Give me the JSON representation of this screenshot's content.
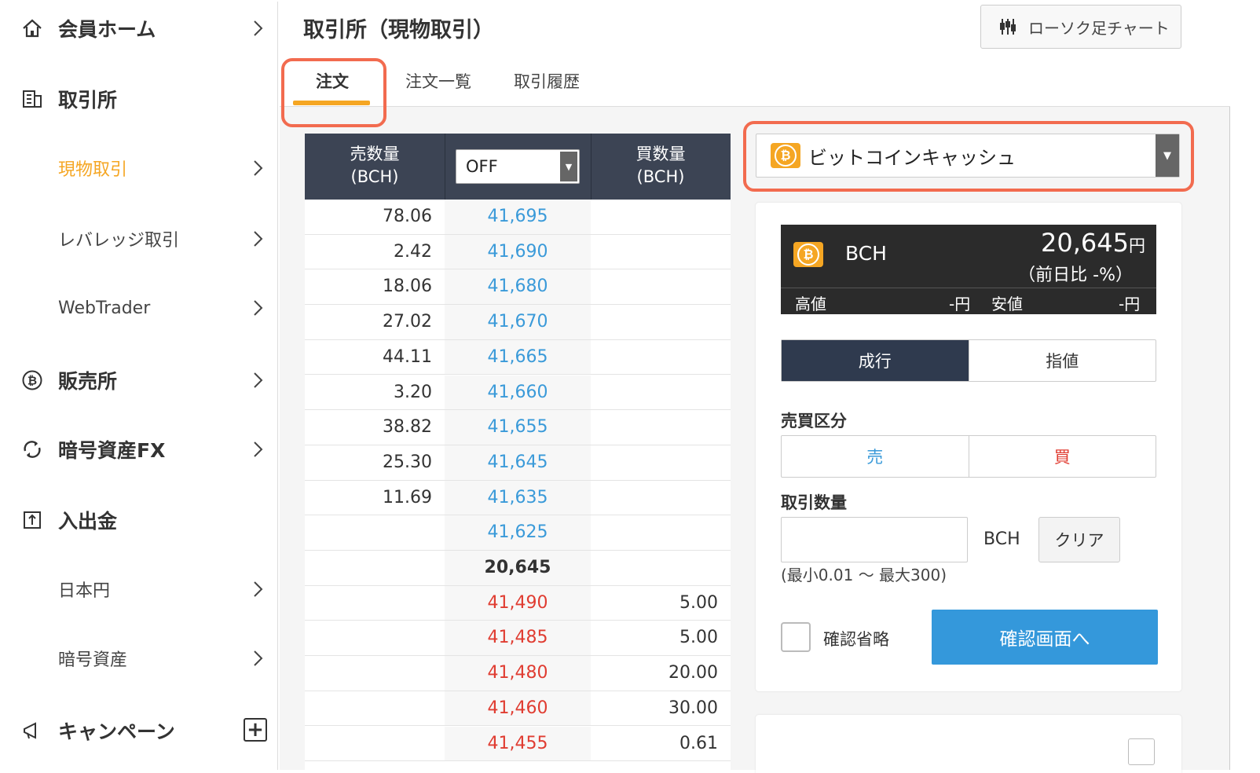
{
  "sidebar": {
    "items": [
      {
        "label": "会員ホーム",
        "icon": "home-icon"
      },
      {
        "label": "取引所",
        "icon": "building-icon"
      },
      {
        "label": "現物取引"
      },
      {
        "label": "レバレッジ取引"
      },
      {
        "label": "WebTrader"
      },
      {
        "label": "販売所",
        "icon": "bitcoin-icon"
      },
      {
        "label": "暗号資産FX",
        "icon": "exchange-icon"
      },
      {
        "label": "入出金",
        "icon": "deposit-icon"
      },
      {
        "label": "日本円"
      },
      {
        "label": "暗号資産"
      },
      {
        "label": "キャンペーン",
        "icon": "megaphone-icon"
      }
    ]
  },
  "header": {
    "title": "取引所（現物取引）",
    "chart_button": "ローソク足チャート",
    "tabs": [
      "注文",
      "注文一覧",
      "取引履歴"
    ]
  },
  "orderbook": {
    "sell_header": "売数量\n(BCH)",
    "buy_header": "買数量\n(BCH)",
    "sell_header_l1": "売数量",
    "sell_header_l2": "(BCH)",
    "buy_header_l1": "買数量",
    "buy_header_l2": "(BCH)",
    "filter_value": "OFF",
    "asks": [
      {
        "qty": "78.06",
        "price": "41,695"
      },
      {
        "qty": "2.42",
        "price": "41,690"
      },
      {
        "qty": "18.06",
        "price": "41,680"
      },
      {
        "qty": "27.02",
        "price": "41,670"
      },
      {
        "qty": "44.11",
        "price": "41,665"
      },
      {
        "qty": "3.20",
        "price": "41,660"
      },
      {
        "qty": "38.82",
        "price": "41,655"
      },
      {
        "qty": "25.30",
        "price": "41,645"
      },
      {
        "qty": "11.69",
        "price": "41,635"
      },
      {
        "qty": "",
        "price": "41,625"
      }
    ],
    "last_price": "20,645",
    "bids": [
      {
        "price": "41,490",
        "qty": "5.00"
      },
      {
        "price": "41,485",
        "qty": "5.00"
      },
      {
        "price": "41,480",
        "qty": "20.00"
      },
      {
        "price": "41,460",
        "qty": "30.00"
      },
      {
        "price": "41,455",
        "qty": "0.61"
      }
    ]
  },
  "order": {
    "coin": "ビットコインキャッシュ",
    "symbol": "BCH",
    "price": "20,645",
    "price_unit": "円",
    "change": "（前日比 -%）",
    "high_label": "高値",
    "high_value": "-円",
    "low_label": "安値",
    "low_value": "-円",
    "order_types": [
      "成行",
      "指値"
    ],
    "side_label": "売買区分",
    "sell": "売",
    "buy": "買",
    "qty_label": "取引数量",
    "qty_value": "",
    "unit": "BCH",
    "clear": "クリア",
    "range": "(最小0.01 〜 最大300)",
    "skip_confirm": "確認省略",
    "confirm": "確認画面へ"
  },
  "colors": {
    "accent": "#f5a623",
    "highlight": "#f26b4f",
    "sell_price": "#3a9ad9",
    "buy_price": "#e03c31",
    "primary_button": "#3498db",
    "dark": "#2f3a4e"
  }
}
